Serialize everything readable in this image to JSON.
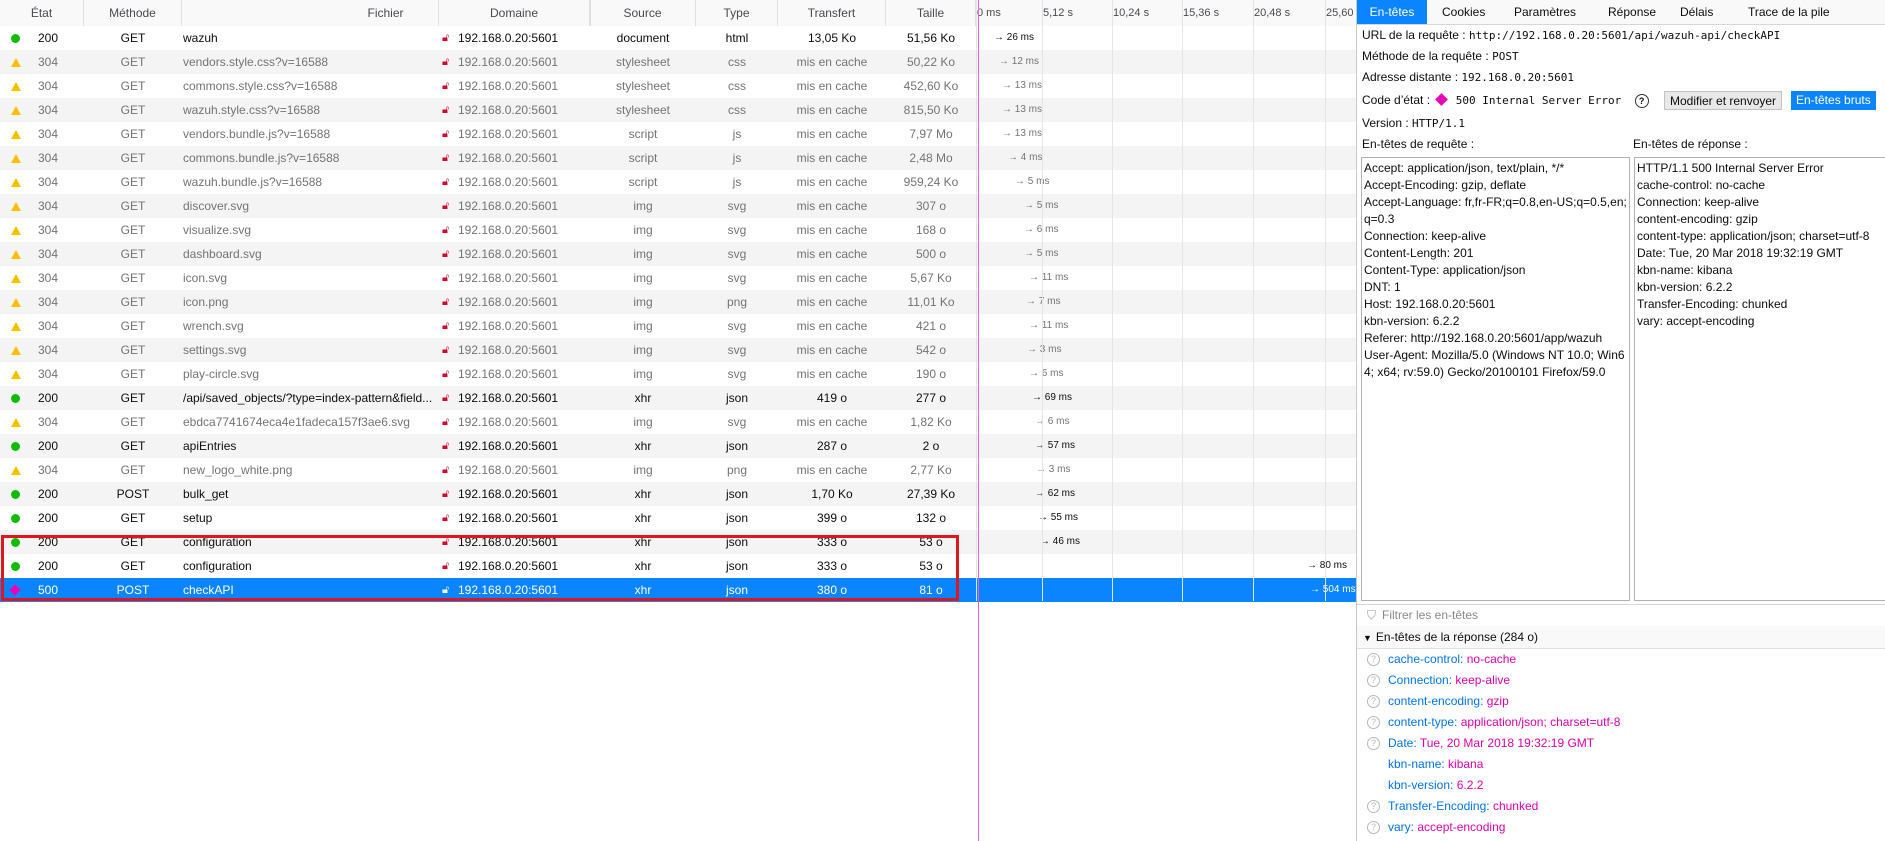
{
  "columns": {
    "status": "État",
    "method": "Méthode",
    "file": "Fichier",
    "domain": "Domaine",
    "source": "Source",
    "type": "Type",
    "transfer": "Transfert",
    "size": "Taille"
  },
  "timeline_ticks": [
    "0 ms",
    "5,12 s",
    "10,24 s",
    "15,36 s",
    "20,48 s",
    "25,60"
  ],
  "requests": [
    {
      "status_icon": "ok",
      "code": "200",
      "method": "GET",
      "file": "wazuh",
      "domain": "192.168.0.20:5601",
      "source": "document",
      "type": "html",
      "transfer": "13,05 Ko",
      "size": "51,56 Ko",
      "timing": "→ 26 ms",
      "cached": false
    },
    {
      "status_icon": "cached",
      "code": "304",
      "method": "GET",
      "file": "vendors.style.css?v=16588",
      "domain": "192.168.0.20:5601",
      "source": "stylesheet",
      "type": "css",
      "transfer": "mis en cache",
      "size": "50,22 Ko",
      "timing": "→ 12 ms",
      "cached": true
    },
    {
      "status_icon": "cached",
      "code": "304",
      "method": "GET",
      "file": "commons.style.css?v=16588",
      "domain": "192.168.0.20:5601",
      "source": "stylesheet",
      "type": "css",
      "transfer": "mis en cache",
      "size": "452,60 Ko",
      "timing": "→ 13 ms",
      "cached": true
    },
    {
      "status_icon": "cached",
      "code": "304",
      "method": "GET",
      "file": "wazuh.style.css?v=16588",
      "domain": "192.168.0.20:5601",
      "source": "stylesheet",
      "type": "css",
      "transfer": "mis en cache",
      "size": "815,50 Ko",
      "timing": "→ 13 ms",
      "cached": true
    },
    {
      "status_icon": "cached",
      "code": "304",
      "method": "GET",
      "file": "vendors.bundle.js?v=16588",
      "domain": "192.168.0.20:5601",
      "source": "script",
      "type": "js",
      "transfer": "mis en cache",
      "size": "7,97 Mo",
      "timing": "→ 13 ms",
      "cached": true
    },
    {
      "status_icon": "cached",
      "code": "304",
      "method": "GET",
      "file": "commons.bundle.js?v=16588",
      "domain": "192.168.0.20:5601",
      "source": "script",
      "type": "js",
      "transfer": "mis en cache",
      "size": "2,48 Mo",
      "timing": "→ 4 ms",
      "cached": true
    },
    {
      "status_icon": "cached",
      "code": "304",
      "method": "GET",
      "file": "wazuh.bundle.js?v=16588",
      "domain": "192.168.0.20:5601",
      "source": "script",
      "type": "js",
      "transfer": "mis en cache",
      "size": "959,24 Ko",
      "timing": "→ 5 ms",
      "cached": true
    },
    {
      "status_icon": "cached",
      "code": "304",
      "method": "GET",
      "file": "discover.svg",
      "domain": "192.168.0.20:5601",
      "source": "img",
      "type": "svg",
      "transfer": "mis en cache",
      "size": "307 o",
      "timing": "→ 5 ms",
      "cached": true
    },
    {
      "status_icon": "cached",
      "code": "304",
      "method": "GET",
      "file": "visualize.svg",
      "domain": "192.168.0.20:5601",
      "source": "img",
      "type": "svg",
      "transfer": "mis en cache",
      "size": "168 o",
      "timing": "→ 6 ms",
      "cached": true
    },
    {
      "status_icon": "cached",
      "code": "304",
      "method": "GET",
      "file": "dashboard.svg",
      "domain": "192.168.0.20:5601",
      "source": "img",
      "type": "svg",
      "transfer": "mis en cache",
      "size": "500 o",
      "timing": "→ 5 ms",
      "cached": true
    },
    {
      "status_icon": "cached",
      "code": "304",
      "method": "GET",
      "file": "icon.svg",
      "domain": "192.168.0.20:5601",
      "source": "img",
      "type": "svg",
      "transfer": "mis en cache",
      "size": "5,67 Ko",
      "timing": "→ 11 ms",
      "cached": true
    },
    {
      "status_icon": "cached",
      "code": "304",
      "method": "GET",
      "file": "icon.png",
      "domain": "192.168.0.20:5601",
      "source": "img",
      "type": "png",
      "transfer": "mis en cache",
      "size": "11,01 Ko",
      "timing": "→ 7 ms",
      "cached": true
    },
    {
      "status_icon": "cached",
      "code": "304",
      "method": "GET",
      "file": "wrench.svg",
      "domain": "192.168.0.20:5601",
      "source": "img",
      "type": "svg",
      "transfer": "mis en cache",
      "size": "421 o",
      "timing": "→ 11 ms",
      "cached": true
    },
    {
      "status_icon": "cached",
      "code": "304",
      "method": "GET",
      "file": "settings.svg",
      "domain": "192.168.0.20:5601",
      "source": "img",
      "type": "svg",
      "transfer": "mis en cache",
      "size": "542 o",
      "timing": "→ 3 ms",
      "cached": true
    },
    {
      "status_icon": "cached",
      "code": "304",
      "method": "GET",
      "file": "play-circle.svg",
      "domain": "192.168.0.20:5601",
      "source": "img",
      "type": "svg",
      "transfer": "mis en cache",
      "size": "190 o",
      "timing": "→ 6 ms",
      "cached": true
    },
    {
      "status_icon": "ok",
      "code": "200",
      "method": "GET",
      "file": "/api/saved_objects/?type=index-pattern&field...",
      "domain": "192.168.0.20:5601",
      "source": "xhr",
      "type": "json",
      "transfer": "419 o",
      "size": "277 o",
      "timing": "→ 69 ms",
      "cached": false
    },
    {
      "status_icon": "cached",
      "code": "304",
      "method": "GET",
      "file": "ebdca7741674eca4e1fadeca157f3ae6.svg",
      "domain": "192.168.0.20:5601",
      "source": "img",
      "type": "svg",
      "transfer": "mis en cache",
      "size": "1,82 Ko",
      "timing": "→ 6 ms",
      "cached": true
    },
    {
      "status_icon": "ok",
      "code": "200",
      "method": "GET",
      "file": "apiEntries",
      "domain": "192.168.0.20:5601",
      "source": "xhr",
      "type": "json",
      "transfer": "287 o",
      "size": "2 o",
      "timing": "→ 57 ms",
      "cached": false
    },
    {
      "status_icon": "cached",
      "code": "304",
      "method": "GET",
      "file": "new_logo_white.png",
      "domain": "192.168.0.20:5601",
      "source": "img",
      "type": "png",
      "transfer": "mis en cache",
      "size": "2,77 Ko",
      "timing": "→ 3 ms",
      "cached": true
    },
    {
      "status_icon": "ok",
      "code": "200",
      "method": "POST",
      "file": "bulk_get",
      "domain": "192.168.0.20:5601",
      "source": "xhr",
      "type": "json",
      "transfer": "1,70 Ko",
      "size": "27,39 Ko",
      "timing": "→ 62 ms",
      "cached": false
    },
    {
      "status_icon": "ok",
      "code": "200",
      "method": "GET",
      "file": "setup",
      "domain": "192.168.0.20:5601",
      "source": "xhr",
      "type": "json",
      "transfer": "399 o",
      "size": "132 o",
      "timing": "→ 55 ms",
      "cached": false
    },
    {
      "status_icon": "ok",
      "code": "200",
      "method": "GET",
      "file": "configuration",
      "domain": "192.168.0.20:5601",
      "source": "xhr",
      "type": "json",
      "transfer": "333 o",
      "size": "53 o",
      "timing": "→ 46 ms",
      "cached": false
    },
    {
      "status_icon": "ok",
      "code": "200",
      "method": "GET",
      "file": "configuration",
      "domain": "192.168.0.20:5601",
      "source": "xhr",
      "type": "json",
      "transfer": "333 o",
      "size": "53 o",
      "timing": "→ 80 ms",
      "cached": false
    },
    {
      "status_icon": "error",
      "code": "500",
      "method": "POST",
      "file": "checkAPI",
      "domain": "192.168.0.20:5601",
      "source": "xhr",
      "type": "json",
      "transfer": "380 o",
      "size": "81 o",
      "timing": "→ 504 ms",
      "cached": false,
      "selected": true
    }
  ],
  "details": {
    "tabs": [
      "En-têtes",
      "Cookies",
      "Paramètres",
      "Réponse",
      "Délais",
      "Trace de la pile"
    ],
    "url_label": "URL de la requête :",
    "url": "http://192.168.0.20:5601/api/wazuh-api/checkAPI",
    "method_label": "Méthode de la requête :",
    "method": "POST",
    "remote_label": "Adresse distante :",
    "remote": "192.168.0.20:5601",
    "status_label": "Code d’état :",
    "status": "500 Internal Server Error",
    "resend_label": "Modifier et renvoyer",
    "raw_label": "En-têtes bruts",
    "version_label": "Version :",
    "version": "HTTP/1.1",
    "req_headers_label": "En-têtes de requête :",
    "resp_headers_label": "En-têtes de réponse :",
    "raw_request": [
      "Accept: application/json, text/plain, */*",
      "Accept-Encoding: gzip, deflate",
      "Accept-Language: fr,fr-FR;q=0.8,en-US;q=0.5,en;q=0.3",
      "Connection: keep-alive",
      "Content-Length: 201",
      "Content-Type: application/json",
      "DNT: 1",
      "Host: 192.168.0.20:5601",
      "kbn-version: 6.2.2",
      "Referer: http://192.168.0.20:5601/app/wazuh",
      "User-Agent: Mozilla/5.0 (Windows NT 10.0; Win64; x64; rv:59.0) Gecko/20100101 Firefox/59.0"
    ],
    "raw_response": [
      "HTTP/1.1 500 Internal Server Error",
      "cache-control: no-cache",
      "Connection: keep-alive",
      "content-encoding: gzip",
      "content-type: application/json; charset=utf-8",
      "Date: Tue, 20 Mar 2018 19:32:19 GMT",
      "kbn-name: kibana",
      "kbn-version: 6.2.2",
      "Transfer-Encoding: chunked",
      "vary: accept-encoding"
    ],
    "filter_placeholder": "Filtrer les en-têtes",
    "resp_section_label": "En-têtes de la réponse (284 o)",
    "resp_headers": [
      {
        "name": "cache-control:",
        "value": "no-cache",
        "help": true
      },
      {
        "name": "Connection:",
        "value": "keep-alive",
        "help": true
      },
      {
        "name": "content-encoding:",
        "value": "gzip",
        "help": true
      },
      {
        "name": "content-type:",
        "value": "application/json; charset=utf-8",
        "help": true
      },
      {
        "name": "Date:",
        "value": "Tue, 20 Mar 2018 19:32:19 GMT",
        "help": true
      },
      {
        "name": "kbn-name:",
        "value": "kibana",
        "help": false
      },
      {
        "name": "kbn-version:",
        "value": "6.2.2",
        "help": false
      },
      {
        "name": "Transfer-Encoding:",
        "value": "chunked",
        "help": true
      },
      {
        "name": "vary:",
        "value": "accept-encoding",
        "help": true
      }
    ]
  },
  "colors": {
    "accent": "#0a84ff",
    "ok": "#12bc00",
    "cached": "#ffbf00",
    "error": "#ed00b5",
    "highlight": "#e0161c"
  }
}
